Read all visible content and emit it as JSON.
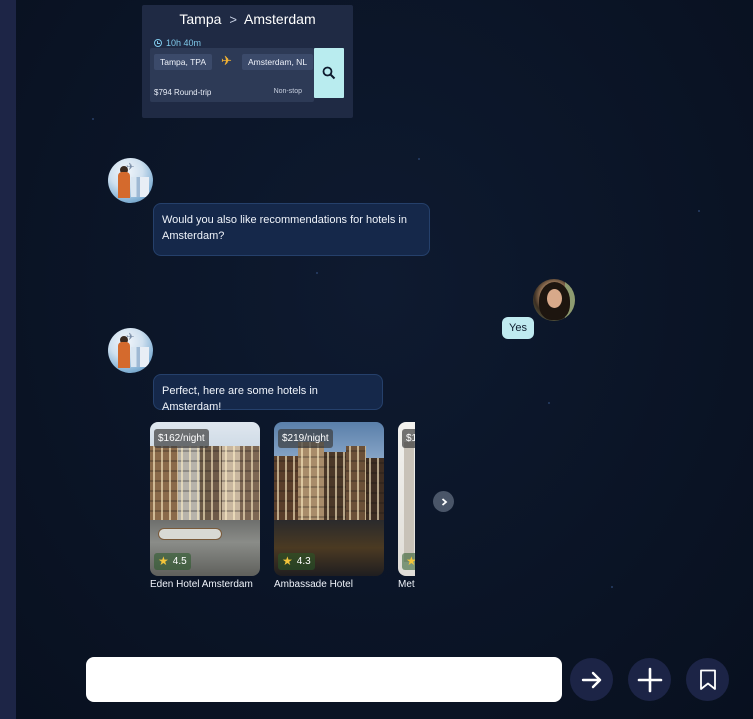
{
  "flight_card": {
    "origin_city": "Tampa",
    "destination_city": "Amsterdam",
    "title_separator": ">",
    "duration": "10h 40m",
    "origin_code": "Tampa, TPA",
    "destination_code": "Amsterdam, NL",
    "price": "$794 Round-trip",
    "stops": "Non-stop",
    "icons": [
      "clock-icon",
      "airplane-icon",
      "search-icon"
    ]
  },
  "messages": [
    {
      "sender": "bot",
      "text": "Would you also like recommendations for hotels in Amsterdam?"
    },
    {
      "sender": "user",
      "text": "Yes"
    },
    {
      "sender": "bot",
      "text": "Perfect, here are some hotels in Amsterdam!"
    }
  ],
  "hotels": [
    {
      "price": "$162/night",
      "rating": "4.5",
      "name": "Eden Hotel Amsterdam"
    },
    {
      "price": "$219/night",
      "rating": "4.3",
      "name": "Ambassade Hotel"
    },
    {
      "price": "$1",
      "rating": "",
      "name": "Met"
    }
  ],
  "composer": {
    "placeholder": "",
    "value": ""
  },
  "actions": [
    "send-arrow-icon",
    "plus-icon",
    "bookmark-icon"
  ],
  "colors": {
    "background": "#0b1426",
    "bubble": "#15284a",
    "user_bubble": "#bfeaf0",
    "accent": "#b9ecef",
    "button": "#1c2446"
  }
}
